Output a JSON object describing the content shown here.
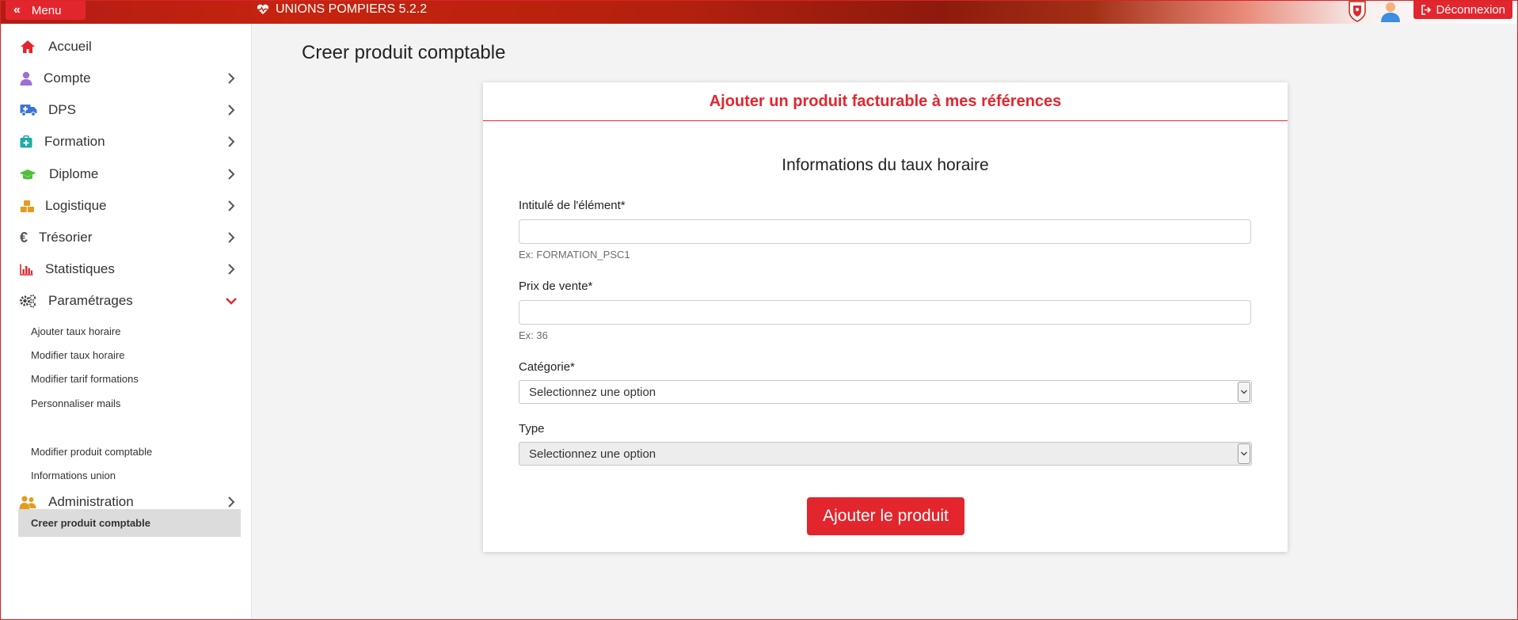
{
  "topbar": {
    "menu_label": "Menu",
    "app_title": "UNIONS POMPIERS 5.2.2",
    "logout_label": "Déconnexion"
  },
  "sidebar": {
    "items": [
      {
        "label": "Accueil",
        "icon": "home-icon",
        "color": "#e3262d"
      },
      {
        "label": "Compte",
        "icon": "user-icon",
        "color": "#9b6fd6"
      },
      {
        "label": "DPS",
        "icon": "ambulance-icon",
        "color": "#3d73d8"
      },
      {
        "label": "Formation",
        "icon": "first-aid-kit-icon",
        "color": "#1eaaa5"
      },
      {
        "label": "Diplome",
        "icon": "graduation-cap-icon",
        "color": "#4fbf3a"
      },
      {
        "label": "Logistique",
        "icon": "cubes-icon",
        "color": "#e59b1f"
      },
      {
        "label": "Trésorier",
        "icon": "euro-icon",
        "color": "#555555"
      },
      {
        "label": "Statistiques",
        "icon": "bar-chart-icon",
        "color": "#e3262d"
      },
      {
        "label": "Paramétrages",
        "icon": "gears-icon",
        "color": "#444444"
      },
      {
        "label": "Administration",
        "icon": "users-icon",
        "color": "#e59b1f"
      }
    ],
    "sub_items": [
      {
        "label": "Ajouter taux horaire"
      },
      {
        "label": "Modifier taux horaire"
      },
      {
        "label": "Modifier tarif formations"
      },
      {
        "label": "Personnaliser mails"
      },
      {
        "label": "Creer produit comptable"
      },
      {
        "label": "Modifier produit comptable"
      },
      {
        "label": "Informations union"
      }
    ]
  },
  "main": {
    "page_title": "Creer produit comptable",
    "card_title": "Ajouter un produit facturable à mes références",
    "section_title": "Informations du taux horaire",
    "fields": {
      "intitule_label": "Intitulé de l'élément*",
      "intitule_value": "",
      "intitule_help": "Ex: FORMATION_PSC1",
      "prix_label": "Prix de vente*",
      "prix_value": "",
      "prix_help": "Ex: 36",
      "categorie_label": "Catégorie*",
      "categorie_selected": "Selectionnez une option",
      "type_label": "Type",
      "type_selected": "Selectionnez une option"
    },
    "submit_label": "Ajouter le produit"
  },
  "colors": {
    "brand_red": "#e3262d",
    "active_bg": "#dcdcdc"
  }
}
